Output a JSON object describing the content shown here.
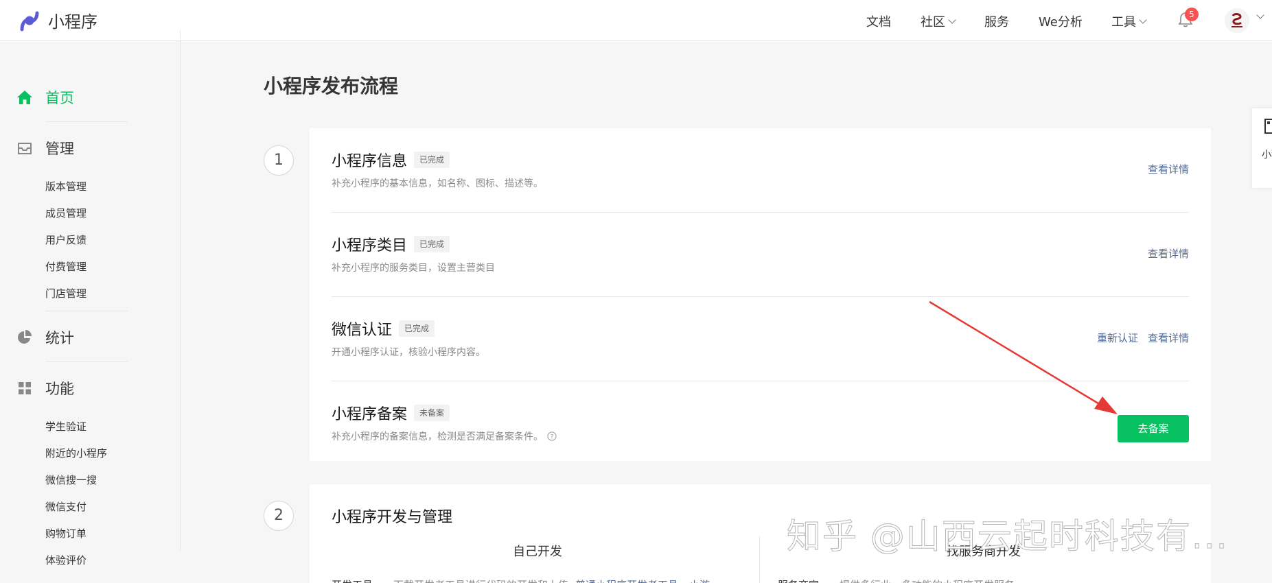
{
  "header": {
    "app_name": "小程序",
    "nav": [
      {
        "label": "文档",
        "caret": false
      },
      {
        "label": "社区",
        "caret": true
      },
      {
        "label": "服务",
        "caret": false
      },
      {
        "label": "We分析",
        "caret": false
      },
      {
        "label": "工具",
        "caret": true
      }
    ],
    "notification_count": "5"
  },
  "sidebar": {
    "home": "首页",
    "manage": "管理",
    "manage_items": [
      "版本管理",
      "成员管理",
      "用户反馈",
      "付费管理",
      "门店管理"
    ],
    "stats": "统计",
    "features": "功能",
    "feature_items": [
      "学生验证",
      "附近的小程序",
      "微信搜一搜",
      "微信支付",
      "购物订单",
      "体验评价"
    ]
  },
  "main": {
    "title": "小程序发布流程",
    "step1": {
      "number": "1",
      "rows": [
        {
          "title": "小程序信息",
          "tag": "已完成",
          "desc": "补充小程序的基本信息，如名称、图标、描述等。",
          "actions": [
            "查看详情"
          ]
        },
        {
          "title": "小程序类目",
          "tag": "已完成",
          "desc": "补充小程序的服务类目，设置主营类目",
          "actions": [
            "查看详情"
          ]
        },
        {
          "title": "微信认证",
          "tag": "已完成",
          "desc": "开通小程序认证，核验小程序内容。",
          "actions": [
            "重新认证",
            "查看详情"
          ]
        },
        {
          "title": "小程序备案",
          "tag": "未备案",
          "desc": "补充小程序的备案信息，检测是否满足备案条件。",
          "button": "去备案"
        }
      ]
    },
    "step2": {
      "number": "2",
      "title": "小程序开发与管理",
      "col_left": "自己开发",
      "col_right": "找服务商开发",
      "left_row_label": "开发工具",
      "left_row_desc": "下载开发者工具进行代码的开发和上传",
      "left_row_link": "普通小程序开发者工具",
      "left_row_link2": "小游",
      "right_row_label": "服务商家",
      "right_row_desc": "提供多行业、多功能的小程序开发服务"
    }
  },
  "float_panel": {
    "text": "小程助"
  },
  "watermark": "知乎 @山西云起时科技有...",
  "colors": {
    "accent": "#07c160",
    "link": "#576b95",
    "badge": "#fa5151",
    "arrow": "#e53935"
  }
}
